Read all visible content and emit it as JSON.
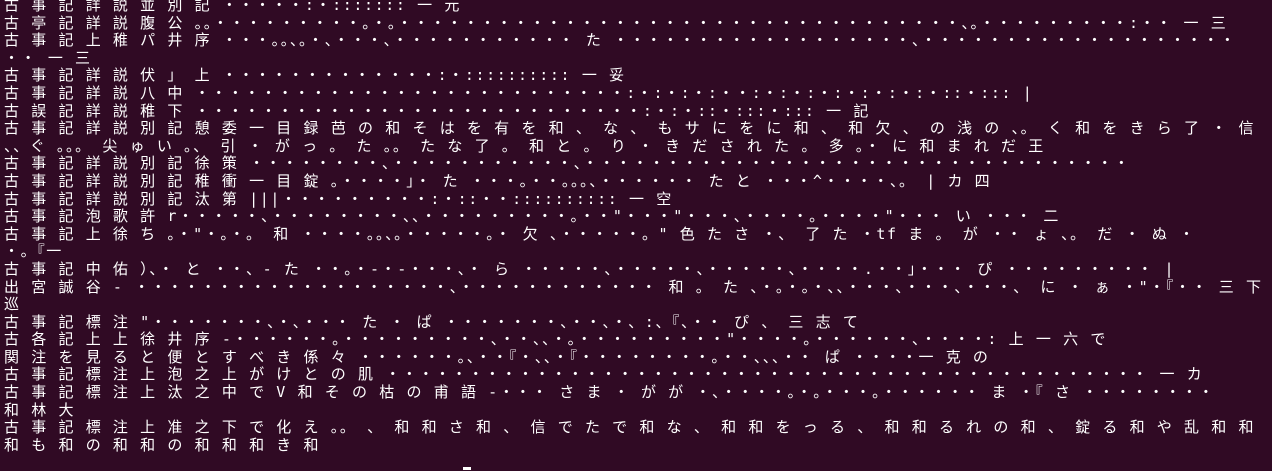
{
  "terminal": {
    "background": "#300a24",
    "foreground": "#ffffff",
    "lines": [
      "古 事 記 詳 説 並 別 記 ・・・・・:・::::::: 一 元",
      "古 亭 記 詳 説 腹 公 。。・・・・・・・・・。・。・・・・・・・・・・・・・・・・・・・・・・・・・・・・・・・・・・、。・・・・・・・・・:・・ 一 三",
      "古 事 記 上 稚 パ 井 序 ・・・。。、。・、・・・、・・・・・・・・・・・ た ・・・・・・・・・・・・・・・・・・、・・・・・・・・・・・・・・・・・・・",
      "・・ 一 三",
      "古 事 記 詳 説 伏 」 上 ・・・・・・・・・・・・・:・:::::::::: 一 妥",
      "古 事 記 詳 説 八 中 ・・・・・・・・・・・・・・・・・・・・・・・・・・:・:・:・:・・:・:・:・:・:・:・:・::・::: |",
      "古 誤 記 詳 説 稚 下 ・・・・・・・・・・・・・・・・・・・・・・・・・・・:・:・::・:::・::: 一 記",
      "古 事 記 詳 説 別 記 憩 委 一 目 録 芭 の 和 そ は を 有 を 和 、 な 、 も サ に を に 和 、 和 欠 、 の 浅 の 、。 く 和 を き ら 了 ・ 信",
      "、、ぐ 。。。 尖 ゅ い 。、 引 ・ が っ 。 た 。。 た な 了 。 和 と 。 り ・ き だ さ れ た 。 多 。・ に 和 ま れ だ 王",
      "古 事 記 詳 説 別 記 徐 策 ・・・・・・・・、・・・・・・・・・・・、・・・・・・・・・・・・・・・・・・・・・・・・・・・・・・・・・",
      "古 事 記 詳 説 別 記 稚 衝 一 目 錠 。・・・・」・ た ・・・。・・。。。、・・・・・・ た と ・・・^・・・・、。 | カ 四",
      "古 事 記 詳 説 別 記 汰 第 |||・・・・・・・・・:・::・・:::::::::: 一 空",
      "古 事 記 泡 歌 許 r・・・・・、・・・・・・・・、、・・・・・・・・・。・・\"・・・\"・・・、・・・・。・・・・\"・・・ い ・・・ 二",
      "古 事 記 上 徐 ち 。・\"・。・。 和 ・・・・。。、。・・・・・。・ 欠 、・・・・・。\" 色 た さ ・、 了 た ・tf ま 。 が ・・ ょ 、。 だ ・ ぬ ・",
      "・。『一",
      "古 事 記 中 佑 ）、・ と ・・、- た ・・。・-・-・・・、・ ら ・・・・・、・・・・・、・・・・・、・・・・.・・」・・・ ぴ ・・・・・・・・・ |",
      "出 宮 誠 谷 - ・・・・・・・・・・・・・・・・・・・、・・・・・・・・・・・・ 和 。 た 、・。・。・、、・・・、・・・、・・・、 に ・ ぁ ・\"・『・・ 三 下",
      "巡",
      "古 事 記 標 注 \"・・・・・・・、・、・・・ た ・ ぱ ・・・・・・・、・・、・、:、『、・・ ぴ 、 三 志 て",
      "古 各 記 上 上 徐 井 序 -・・・・・・。・・・・・・・・・、・・、、・。・・・・・・・・・\"・・・・。・・・・・・、・・・・: 上 一 六 で",
      "関 注 を 見 る と 便 と す べ き 係 々 ・・・・・・。、・・『・、、・『・・・・・・・・。・・、、、・・ ぱ ・・・・一 克 の",
      "古 事 記 標 注 上 泡 之 上 が け と の 肌 ・・・・・・・・・・・・・・・・・・・・・・・・・・・・・・・・・・・・・・・・・・・・・・ 一 カ",
      "古 事 記 標 注 上 汰 之 中 で V 和 そ の 枯 の 甫 語 -・・・ さ ま ・ が が ・、・・・・。・。・・・。・・・・・・ ま ・『 さ ・・・・・・・・",
      "和 林 大",
      "古 事 記 標 注 上 准 之 下 で 化 え 。。 、 和 和 さ 和 、 信 で た で 和 な 、 和 和 を っ る 、 和 和 る れ の 和 、 錠 る 和 や 乱 和 和",
      "和 も 和 の 和 和 の 和 和 和 き 和"
    ]
  }
}
